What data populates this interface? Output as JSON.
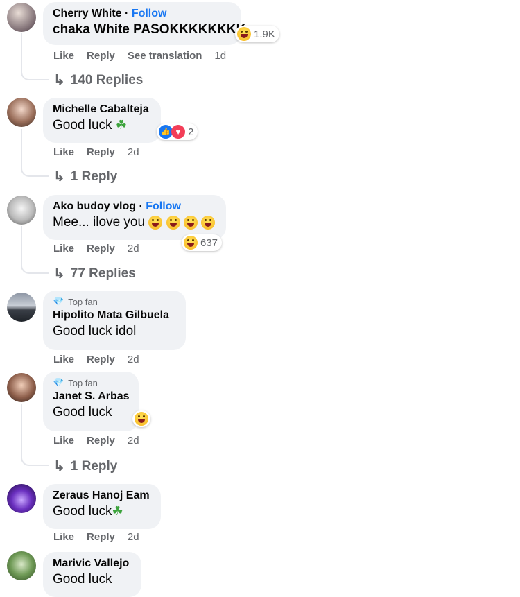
{
  "actions": {
    "like": "Like",
    "reply": "Reply",
    "see_translation": "See translation"
  },
  "colors": {
    "follow": "#1877f2",
    "muted": "#65676b",
    "bubble": "#f0f2f5"
  },
  "comments": [
    {
      "name": "Cherry White",
      "follow": "Follow",
      "text": "chaka White PASOKKKKKKKK",
      "reaction_count": "1.9K",
      "time": "1d",
      "replies": "140 Replies"
    },
    {
      "name": "Michelle Cabalteja",
      "text": "Good luck",
      "reaction_count": "2",
      "time": "2d",
      "replies": "1 Reply"
    },
    {
      "name": "Ako budoy vlog",
      "follow": "Follow",
      "text": "Mee... ilove you",
      "reaction_count": "637",
      "time": "2d",
      "replies": "77 Replies"
    },
    {
      "badge": "Top fan",
      "name": "Hipolito Mata Gilbuela",
      "text": "Good luck idol",
      "time": "2d"
    },
    {
      "badge": "Top fan",
      "name": "Janet S. Arbas",
      "text": "Good luck",
      "time": "2d",
      "replies": "1 Reply"
    },
    {
      "name": "Zeraus Hanoj Eam",
      "text": "Good luck",
      "time": "2d"
    },
    {
      "name": "Marivic Vallejo",
      "text": "Good luck"
    }
  ],
  "icons": {
    "reply_arrow": "reply-arrow-icon",
    "top_fan": "diamond-icon",
    "haha": "haha-emoji",
    "like": "like-reaction",
    "love": "love-reaction",
    "clover": "four-leaf-clover-emoji"
  }
}
